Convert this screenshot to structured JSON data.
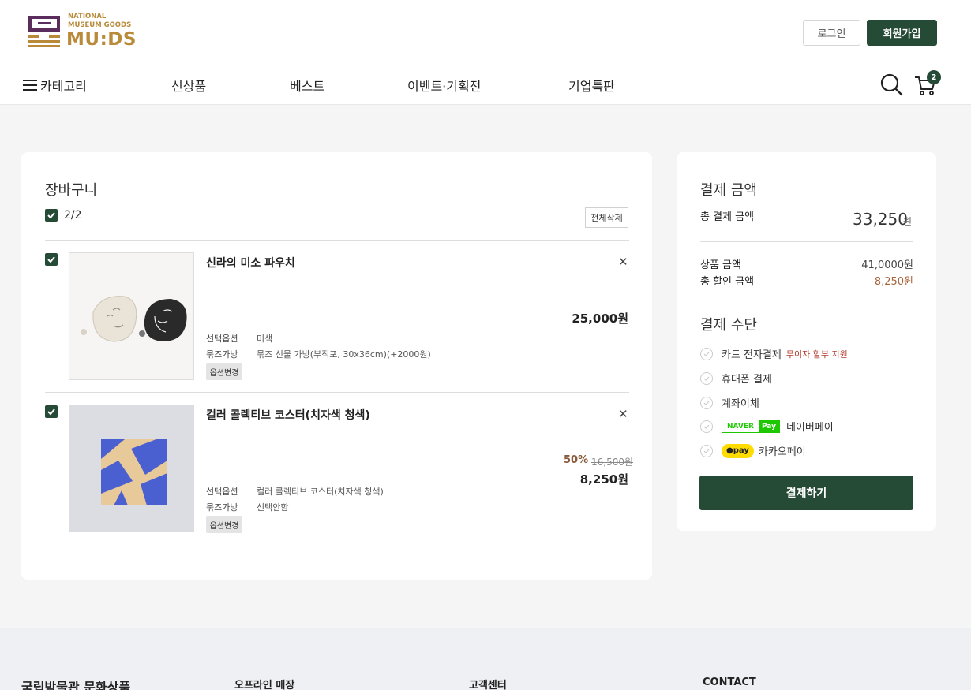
{
  "brand": {
    "line1": "NATIONAL",
    "line2": "MUSEUM GOODS",
    "name": "MU:DS"
  },
  "header": {
    "login": "로그인",
    "signup": "회원가입",
    "cart_count": "2"
  },
  "nav": [
    "카테고리",
    "신상품",
    "베스트",
    "이벤트·기획전",
    "기업특판"
  ],
  "cart": {
    "title": "장바구니",
    "selected_count": "2/2",
    "delete_all": "전체삭제",
    "items": [
      {
        "name": "신라의 미소 파우치",
        "price": "25,000원",
        "options": [
          {
            "label": "선택옵션",
            "value": "미색"
          },
          {
            "label": "묶즈가방",
            "value": "묶즈 선물 가방(부직포, 30x36cm)(+2000원)"
          }
        ],
        "change_option": "옵션변경"
      },
      {
        "name": "컬러 콜렉티브 코스터(치자색 청색)",
        "discount": "50%",
        "original_price": "16,500원",
        "price": "8,250원",
        "options": [
          {
            "label": "선택옵션",
            "value": "컬러 콜렉티브 코스터(치자색 청색)"
          },
          {
            "label": "묶즈가방",
            "value": "선택안함"
          }
        ],
        "change_option": "옵션변경"
      }
    ]
  },
  "payment": {
    "title": "결제 금액",
    "total_label": "총 결제 금액",
    "total_value": "33,250",
    "won": "원",
    "product_label": "상품 금액",
    "product_value": "41,0000원",
    "discount_label": "총 할인 금액",
    "discount_value": "-8,250원",
    "method_title": "결제 수단",
    "methods": [
      "카드 전자결제",
      "휴대폰 결제",
      "계좌이체",
      "네이버페이",
      "카카오페이"
    ],
    "card_badge": "무이자 할부 지원",
    "naver_logo": "NAVER",
    "naver_pay": "Pay",
    "kakao_pay": "pay",
    "pay_button": "결제하기"
  },
  "footer": {
    "title": "국립박물관 문화상품",
    "columns": [
      "오프라인 매장",
      "고객센터",
      "CONTACT"
    ]
  },
  "colors": {
    "accent": "#254a35",
    "brand_gold": "#b88a3a",
    "discount": "#8a5a3a"
  }
}
